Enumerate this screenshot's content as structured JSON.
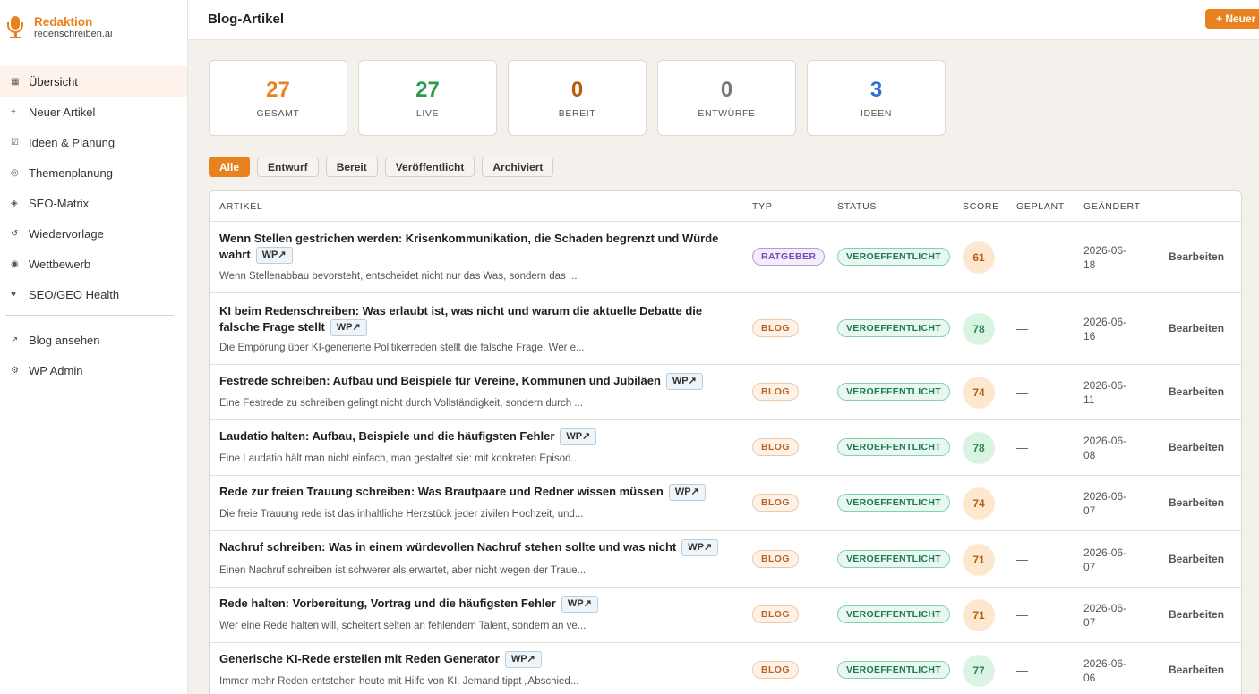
{
  "brand": {
    "title": "Redaktion",
    "subtitle": "redenschreiben.ai"
  },
  "sidebar": {
    "items": [
      {
        "icon": "▦",
        "label": "Übersicht",
        "active": true
      },
      {
        "icon": "+",
        "label": "Neuer Artikel"
      },
      {
        "icon": "☑",
        "label": "Ideen & Planung"
      },
      {
        "icon": "◎",
        "label": "Themenplanung"
      },
      {
        "icon": "◈",
        "label": "SEO-Matrix"
      },
      {
        "icon": "↺",
        "label": "Wiedervorlage"
      },
      {
        "icon": "◉",
        "label": "Wettbewerb"
      },
      {
        "icon": "♥",
        "label": "SEO/GEO Health"
      }
    ],
    "links": [
      {
        "icon": "↗",
        "label": "Blog ansehen"
      },
      {
        "icon": "⚙",
        "label": "WP Admin"
      }
    ]
  },
  "header": {
    "title": "Blog-Artikel",
    "new_button": "+ Neuer"
  },
  "stats": [
    {
      "value": "27",
      "label": "GESAMT",
      "color": "#e8821e"
    },
    {
      "value": "27",
      "label": "LIVE",
      "color": "#2e9a4f"
    },
    {
      "value": "0",
      "label": "BEREIT",
      "color": "#b55d10"
    },
    {
      "value": "0",
      "label": "ENTWÜRFE",
      "color": "#777777"
    },
    {
      "value": "3",
      "label": "IDEEN",
      "color": "#2f6fd6"
    }
  ],
  "filters": [
    "Alle",
    "Entwurf",
    "Bereit",
    "Veröffentlicht",
    "Archiviert"
  ],
  "table": {
    "columns": {
      "artikel": "ARTIKEL",
      "typ": "TYP",
      "status": "STATUS",
      "score": "SCORE",
      "geplant": "GEPLANT",
      "geaendert": "GEÄNDERT"
    },
    "wp_label": "WP↗",
    "edit_label": "Bearbeiten",
    "rows": [
      {
        "title": "Wenn Stellen gestrichen werden: Krisenkommunikation, die Schaden begrenzt und Würde wahrt",
        "excerpt": "Wenn Stellenabbau bevorsteht, entscheidet nicht nur das Was, sondern das ...",
        "type": "RATGEBER",
        "status": "VEROEFFENTLICHT",
        "score": "61",
        "planned": "—",
        "date1": "2026-06-",
        "date2": "18"
      },
      {
        "title": "KI beim Redenschreiben: Was erlaubt ist, was nicht und warum die aktuelle Debatte die falsche Frage stellt",
        "excerpt": "Die Empörung über KI-generierte Politikerreden stellt die falsche Frage. Wer e...",
        "type": "BLOG",
        "status": "VEROEFFENTLICHT",
        "score": "78",
        "planned": "—",
        "date1": "2026-06-",
        "date2": "16"
      },
      {
        "title": "Festrede schreiben: Aufbau und Beispiele für Vereine, Kommunen und Jubiläen",
        "excerpt": "Eine Festrede zu schreiben gelingt nicht durch Vollständigkeit, sondern durch ...",
        "type": "BLOG",
        "status": "VEROEFFENTLICHT",
        "score": "74",
        "planned": "—",
        "date1": "2026-06-",
        "date2": "11"
      },
      {
        "title": "Laudatio halten: Aufbau, Beispiele und die häufigsten Fehler",
        "excerpt": "Eine Laudatio hält man nicht einfach, man gestaltet sie: mit konkreten Episod...",
        "type": "BLOG",
        "status": "VEROEFFENTLICHT",
        "score": "78",
        "planned": "—",
        "date1": "2026-06-",
        "date2": "08"
      },
      {
        "title": "Rede zur freien Trauung schreiben: Was Brautpaare und Redner wissen müssen",
        "excerpt": "Die freie Trauung rede ist das inhaltliche Herzstück jeder zivilen Hochzeit, und...",
        "type": "BLOG",
        "status": "VEROEFFENTLICHT",
        "score": "74",
        "planned": "—",
        "date1": "2026-06-",
        "date2": "07"
      },
      {
        "title": "Nachruf schreiben: Was in einem würdevollen Nachruf stehen sollte und was nicht",
        "excerpt": "Einen Nachruf schreiben ist schwerer als erwartet, aber nicht wegen der Traue...",
        "type": "BLOG",
        "status": "VEROEFFENTLICHT",
        "score": "71",
        "planned": "—",
        "date1": "2026-06-",
        "date2": "07"
      },
      {
        "title": "Rede halten: Vorbereitung, Vortrag und die häufigsten Fehler",
        "excerpt": "Wer eine Rede halten will, scheitert selten an fehlendem Talent, sondern an ve...",
        "type": "BLOG",
        "status": "VEROEFFENTLICHT",
        "score": "71",
        "planned": "—",
        "date1": "2026-06-",
        "date2": "07"
      },
      {
        "title": "Generische KI-Rede erstellen mit Reden Generator",
        "excerpt": "Immer mehr Reden entstehen heute mit Hilfe von KI. Jemand tippt „Abschied...",
        "type": "BLOG",
        "status": "VEROEFFENTLICHT",
        "score": "77",
        "planned": "—",
        "date1": "2026-06-",
        "date2": "06"
      }
    ]
  }
}
